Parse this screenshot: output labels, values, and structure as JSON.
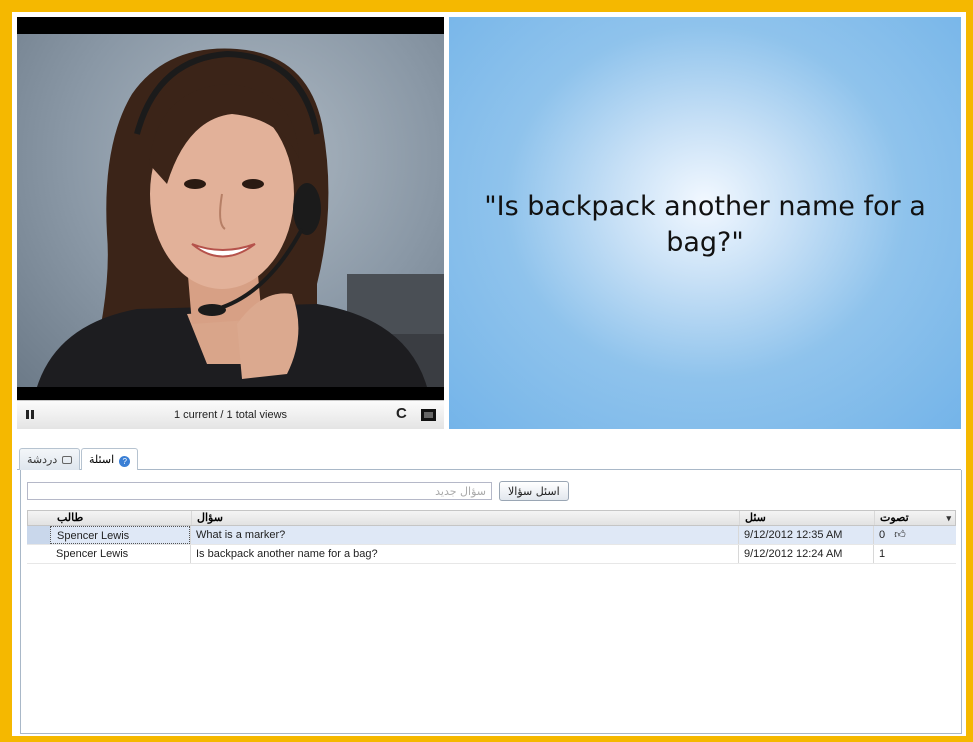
{
  "player": {
    "views_text": "1 current / 1 total views",
    "pause_icon": "pause-icon",
    "refresh_icon": "refresh-icon",
    "refresh_glyph": "C",
    "fullscreen_icon": "fullscreen-icon"
  },
  "slide": {
    "text": "\"Is backpack another name for a bag?\""
  },
  "tabs": [
    {
      "label": "دردشة",
      "icon": "chat-icon",
      "active": false
    },
    {
      "label": "اسئلة",
      "icon": "question-icon",
      "active": true
    }
  ],
  "questions_panel": {
    "input_placeholder": "سؤال جديد",
    "ask_button": "اسئل سؤالا",
    "columns": {
      "student": "طالب",
      "question": "سؤال",
      "asked": "سئل",
      "votes": "تصوت",
      "sort_icon": "▾"
    },
    "rows": [
      {
        "student": "Spencer Lewis",
        "question": "What is a marker?",
        "asked": "9/12/2012 12:35 AM",
        "votes": "0",
        "thumb": "thumbs-up-icon"
      },
      {
        "student": "Spencer Lewis",
        "question": "Is backpack another name for a bag?",
        "asked": "9/12/2012 12:24 AM",
        "votes": "1"
      }
    ]
  },
  "colors": {
    "border_accent": "#f5b800",
    "slide_blue": "#74b4e9",
    "selected_row": "#dfe8f6"
  }
}
